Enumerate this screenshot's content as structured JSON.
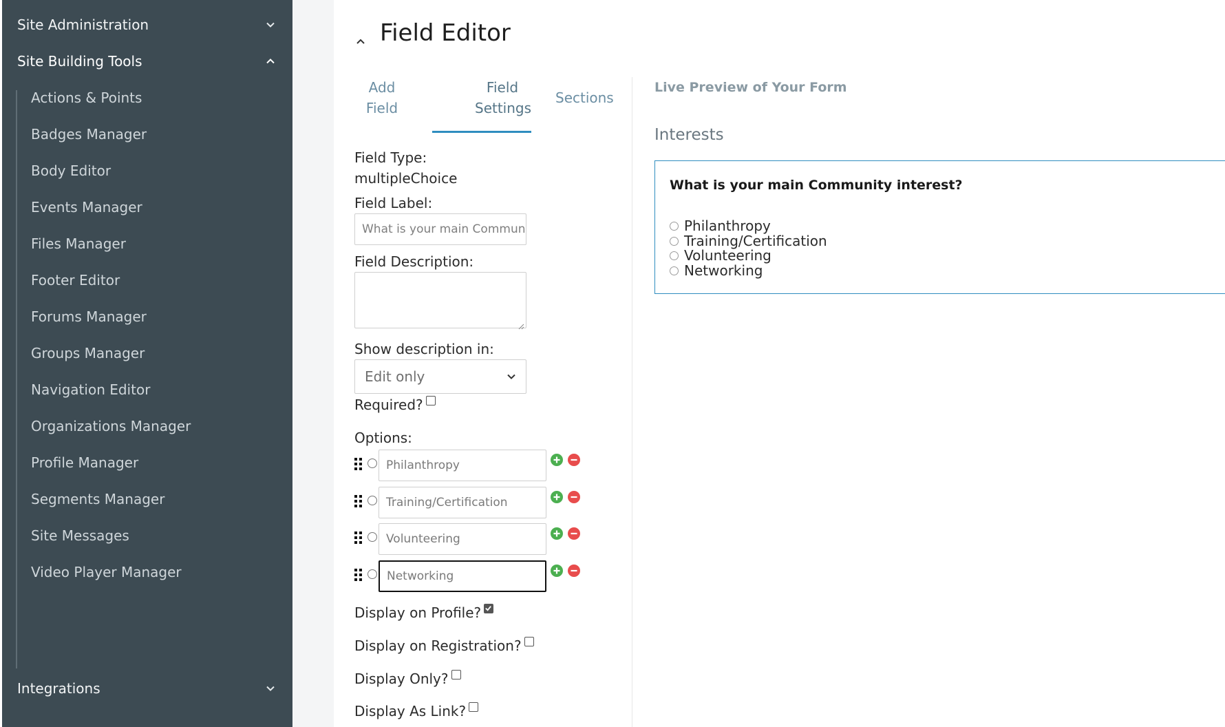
{
  "sidebar": {
    "sections": [
      {
        "label": "Site Administration",
        "expanded": false
      },
      {
        "label": "Site Building Tools",
        "expanded": true
      },
      {
        "label": "Integrations",
        "expanded": false
      }
    ],
    "items": [
      {
        "label": "Actions & Points"
      },
      {
        "label": "Badges Manager"
      },
      {
        "label": "Body Editor"
      },
      {
        "label": "Events Manager"
      },
      {
        "label": "Files Manager"
      },
      {
        "label": "Footer Editor"
      },
      {
        "label": "Forums Manager"
      },
      {
        "label": "Groups Manager"
      },
      {
        "label": "Navigation Editor"
      },
      {
        "label": "Organizations Manager"
      },
      {
        "label": "Profile Manager"
      },
      {
        "label": "Segments Manager"
      },
      {
        "label": "Site Messages"
      },
      {
        "label": "Video Player Manager"
      }
    ]
  },
  "editor": {
    "title": "Field Editor",
    "tabs": [
      {
        "label": "Add Field"
      },
      {
        "label": "Field Settings"
      },
      {
        "label": "Sections"
      }
    ],
    "active_tab": "Field Settings"
  },
  "form": {
    "field_type_label": "Field Type:",
    "field_type_value": "multipleChoice",
    "field_label_label": "Field Label:",
    "field_label_value": "What is your main Communi",
    "field_description_label": "Field Description:",
    "field_description_value": "",
    "show_description_label": "Show description in:",
    "show_description_value": "Edit only",
    "required_label": "Required?",
    "required_checked": false,
    "options_label": "Options:",
    "options": [
      {
        "value": "Philanthropy"
      },
      {
        "value": "Training/Certification"
      },
      {
        "value": "Volunteering"
      },
      {
        "value": "Networking"
      }
    ],
    "display_on_profile_label": "Display on Profile?",
    "display_on_profile_checked": true,
    "display_on_registration_label": "Display on Registration?",
    "display_on_registration_checked": false,
    "display_only_label": "Display Only?",
    "display_only_checked": false,
    "display_as_link_label": "Display As Link?",
    "display_as_link_checked": false
  },
  "preview": {
    "heading": "Live Preview of Your Form",
    "section_title": "Interests",
    "question": "What is your main Community interest?",
    "options": [
      "Philanthropy",
      "Training/Certification",
      "Volunteering",
      "Networking"
    ]
  },
  "colors": {
    "sidebar_bg": "#3d4b53",
    "accent": "#2f8dbf",
    "add_green": "#4caf50",
    "remove_red": "#e84c4c"
  }
}
